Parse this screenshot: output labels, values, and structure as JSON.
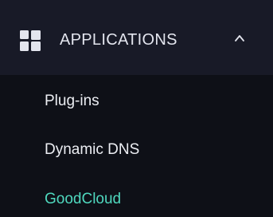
{
  "sidebar": {
    "section": {
      "label": "APPLICATIONS",
      "icon": "apps-grid-icon",
      "expanded": true,
      "chevron": "chevron-up-icon"
    },
    "items": [
      {
        "label": "Plug-ins",
        "active": false
      },
      {
        "label": "Dynamic DNS",
        "active": false
      },
      {
        "label": "GoodCloud",
        "active": true
      }
    ],
    "colors": {
      "background": "#0e1017",
      "header_background": "#181a27",
      "text": "#eceef3",
      "active_text": "#4fd8be",
      "icon": "#e3e5ee"
    }
  }
}
